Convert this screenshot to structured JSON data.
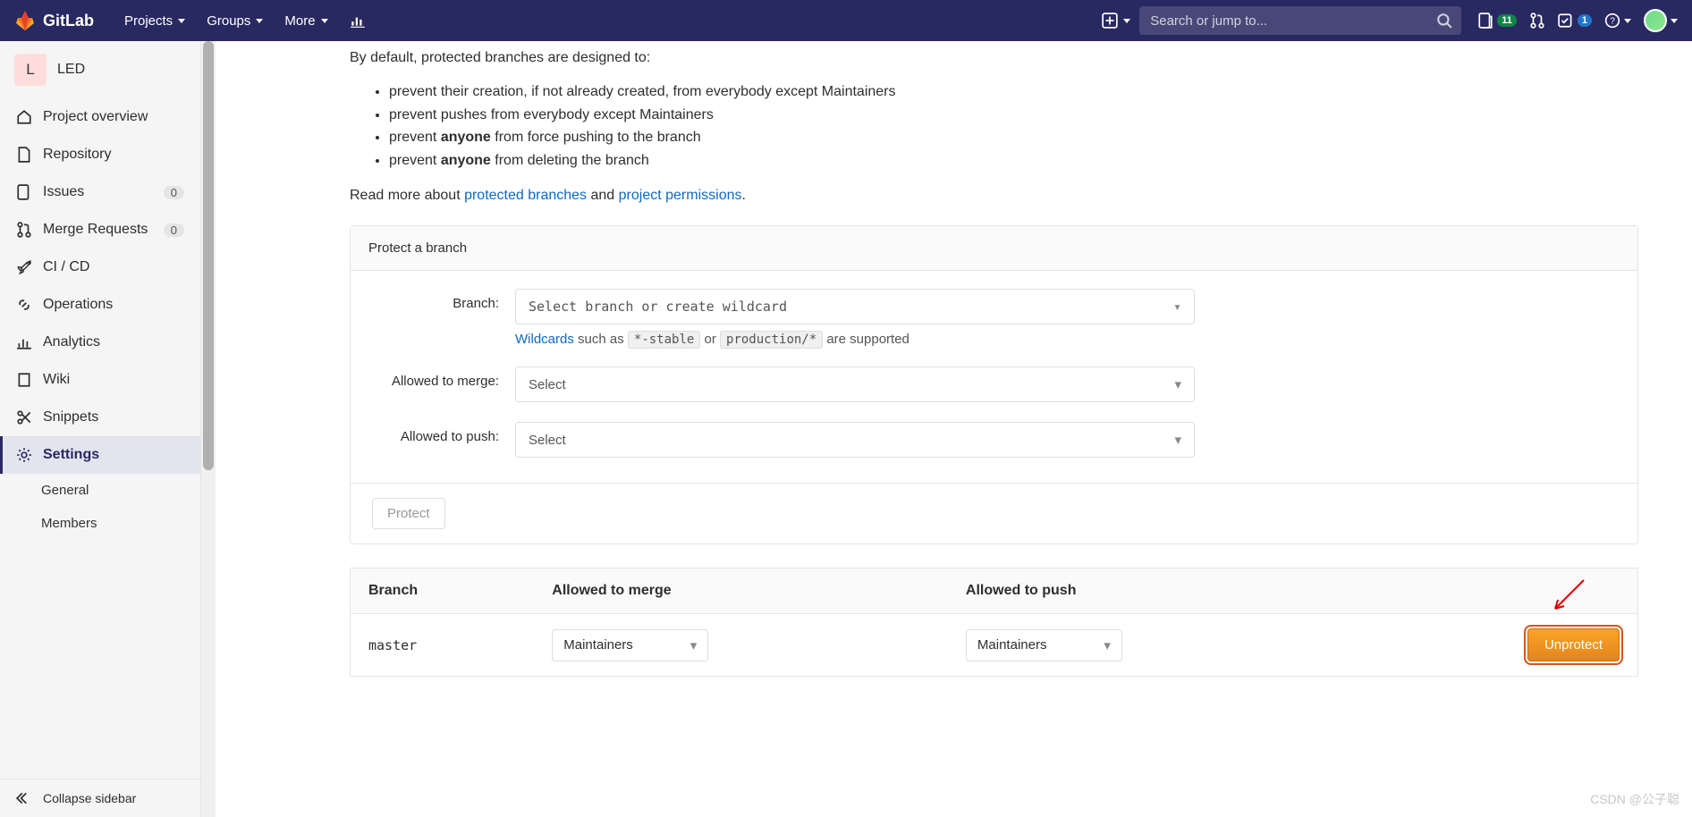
{
  "brand": "GitLab",
  "nav": {
    "projects": "Projects",
    "groups": "Groups",
    "more": "More"
  },
  "search": {
    "placeholder": "Search or jump to..."
  },
  "topbar": {
    "issues_count": "11",
    "todos_count": "1"
  },
  "project": {
    "avatar_letter": "L",
    "name": "LED"
  },
  "sidebar": {
    "items": [
      {
        "label": "Project overview"
      },
      {
        "label": "Repository"
      },
      {
        "label": "Issues",
        "count": "0"
      },
      {
        "label": "Merge Requests",
        "count": "0"
      },
      {
        "label": "CI / CD"
      },
      {
        "label": "Operations"
      },
      {
        "label": "Analytics"
      },
      {
        "label": "Wiki"
      },
      {
        "label": "Snippets"
      },
      {
        "label": "Settings"
      }
    ],
    "settings_sub": [
      {
        "label": "General"
      },
      {
        "label": "Members"
      }
    ],
    "collapse": "Collapse sidebar"
  },
  "content": {
    "intro": "By default, protected branches are designed to:",
    "bullets": {
      "b1": "prevent their creation, if not already created, from everybody except Maintainers",
      "b2": "prevent pushes from everybody except Maintainers",
      "b3_pre": "prevent ",
      "b3_strong": "anyone",
      "b3_post": " from force pushing to the branch",
      "b4_pre": "prevent ",
      "b4_strong": "anyone",
      "b4_post": " from deleting the branch"
    },
    "readmore_pre": "Read more about ",
    "readmore_link1": "protected branches",
    "readmore_mid": " and ",
    "readmore_link2": "project permissions",
    "readmore_post": ".",
    "panel_title": "Protect a branch",
    "form": {
      "branch_label": "Branch:",
      "branch_placeholder": "Select branch or create wildcard",
      "wildcards_link": "Wildcards",
      "wildcards_text1": " such as ",
      "wildcards_code1": "*-stable",
      "wildcards_text2": " or ",
      "wildcards_code2": "production/*",
      "wildcards_text3": " are supported",
      "merge_label": "Allowed to merge:",
      "merge_placeholder": "Select",
      "push_label": "Allowed to push:",
      "push_placeholder": "Select",
      "protect_btn": "Protect"
    },
    "table": {
      "h_branch": "Branch",
      "h_merge": "Allowed to merge",
      "h_push": "Allowed to push",
      "rows": [
        {
          "branch": "master",
          "merge": "Maintainers",
          "push": "Maintainers",
          "action": "Unprotect"
        }
      ]
    }
  },
  "watermark": "CSDN @公子聪"
}
